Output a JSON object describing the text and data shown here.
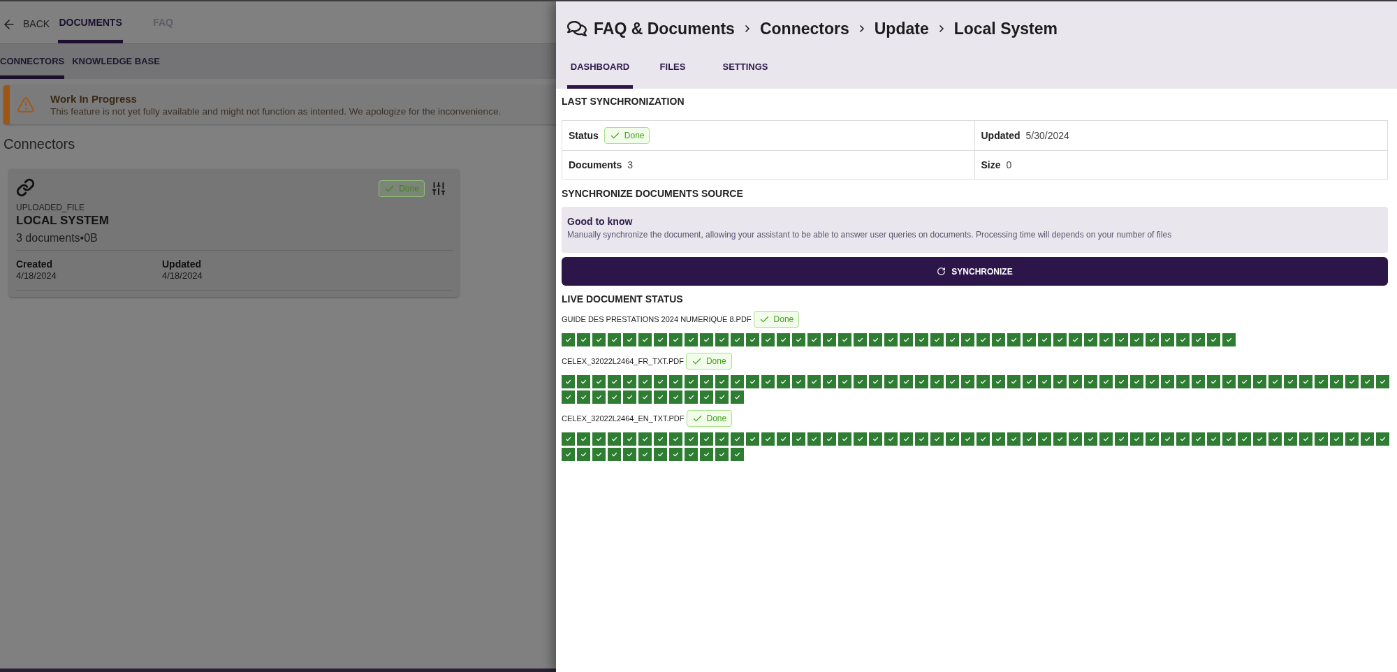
{
  "background_page": {
    "top_nav": {
      "back": "BACK",
      "tabs": [
        {
          "label": "DOCUMENTS",
          "selected": true
        },
        {
          "label": "FAQ",
          "selected": false
        }
      ]
    },
    "sub_tabs": [
      {
        "label": "CONNECTORS",
        "selected": true
      },
      {
        "label": "KNOWLEDGE BASE",
        "selected": false
      }
    ],
    "alert": {
      "title": "Work In Progress",
      "message": "This feature is not yet fully available and might not function as intented. We apologize for the inconvenience."
    },
    "heading": "Connectors",
    "connector_card": {
      "status": "Done",
      "type": "UPLOADED_FILE",
      "name": "LOCAL SYSTEM",
      "summary": "3 documents•0B",
      "fields": [
        {
          "label": "Created",
          "value": "4/18/2024"
        },
        {
          "label": "Updated",
          "value": "4/18/2024"
        }
      ]
    }
  },
  "panel": {
    "breadcrumb": [
      "FAQ & Documents",
      "Connectors",
      "Update",
      "Local System"
    ],
    "tabs": [
      {
        "label": "DASHBOARD",
        "selected": true
      },
      {
        "label": "FILES",
        "selected": false
      },
      {
        "label": "SETTINGS",
        "selected": false
      }
    ],
    "last_sync": {
      "title": "LAST SYNCHRONIZATION",
      "cells": [
        {
          "label": "Status",
          "kind": "badge",
          "value": "Done"
        },
        {
          "label": "Updated",
          "kind": "text",
          "value": "5/30/2024"
        },
        {
          "label": "Documents",
          "kind": "text",
          "value": "3"
        },
        {
          "label": "Size",
          "kind": "text",
          "value": "0"
        }
      ]
    },
    "sync_source": {
      "title": "SYNCHRONIZE DOCUMENTS SOURCE",
      "info": {
        "title": "Good to know",
        "text": "Manually synchronize the document, allowing your assistant to be able to answer user queries on documents. Processing time will depends on your number of files"
      },
      "button": "SYNCHRONIZE"
    },
    "live_status": {
      "title": "LIVE DOCUMENT STATUS",
      "documents": [
        {
          "name": "GUIDE DES PRESTATIONS 2024 NUMERIQUE 8.PDF",
          "status": "Done",
          "chunks": [
            {
              "done": true
            },
            {
              "done": true
            },
            {
              "done": true
            },
            {
              "done": true
            },
            {
              "done": true
            },
            {
              "done": true
            },
            {
              "done": true
            },
            {
              "done": true
            },
            {
              "done": true
            },
            {
              "done": true
            },
            {
              "done": true
            },
            {
              "done": true
            },
            {
              "done": true
            },
            {
              "done": true
            },
            {
              "done": true
            },
            {
              "done": true
            },
            {
              "done": true
            },
            {
              "done": true
            },
            {
              "done": true
            },
            {
              "done": true
            },
            {
              "done": true
            },
            {
              "done": true
            },
            {
              "done": true
            },
            {
              "done": true
            },
            {
              "done": true
            },
            {
              "done": true
            },
            {
              "done": true
            },
            {
              "done": true
            },
            {
              "done": true
            },
            {
              "done": true
            },
            {
              "done": true
            },
            {
              "done": true
            },
            {
              "done": true
            },
            {
              "done": true
            },
            {
              "done": true
            },
            {
              "done": true
            },
            {
              "done": true
            },
            {
              "done": true
            },
            {
              "done": true
            },
            {
              "done": true
            },
            {
              "done": true
            },
            {
              "done": true
            },
            {
              "done": true
            },
            {
              "done": true
            }
          ]
        },
        {
          "name": "CELEX_32022L2464_FR_TXT.PDF",
          "status": "Done",
          "chunks": [
            {
              "done": true
            },
            {
              "done": true
            },
            {
              "done": true
            },
            {
              "done": true
            },
            {
              "done": true
            },
            {
              "done": true
            },
            {
              "done": true
            },
            {
              "done": true
            },
            {
              "done": true
            },
            {
              "done": true
            },
            {
              "done": true
            },
            {
              "done": true
            },
            {
              "done": true
            },
            {
              "done": true
            },
            {
              "done": true
            },
            {
              "done": true
            },
            {
              "done": true
            },
            {
              "done": true
            },
            {
              "done": true
            },
            {
              "done": true
            },
            {
              "done": true
            },
            {
              "done": true
            },
            {
              "done": true
            },
            {
              "done": true
            },
            {
              "done": true
            },
            {
              "done": true
            },
            {
              "done": true
            },
            {
              "done": true
            },
            {
              "done": true
            },
            {
              "done": true
            },
            {
              "done": true
            },
            {
              "done": true
            },
            {
              "done": true
            },
            {
              "done": true
            },
            {
              "done": true
            },
            {
              "done": true
            },
            {
              "done": true
            },
            {
              "done": true
            },
            {
              "done": true
            },
            {
              "done": true
            },
            {
              "done": true
            },
            {
              "done": true
            },
            {
              "done": true
            },
            {
              "done": true
            },
            {
              "done": true
            },
            {
              "done": true
            },
            {
              "done": true
            },
            {
              "done": true
            },
            {
              "done": true
            },
            {
              "done": true
            },
            {
              "done": true
            },
            {
              "done": true
            },
            {
              "done": true
            },
            {
              "done": true
            },
            {
              "done": true
            },
            {
              "done": true
            },
            {
              "done": true
            },
            {
              "done": true
            },
            {
              "done": true
            },
            {
              "done": true
            },
            {
              "done": true
            },
            {
              "done": true
            },
            {
              "done": true
            },
            {
              "done": true
            },
            {
              "done": true
            },
            {
              "done": true
            }
          ]
        },
        {
          "name": "CELEX_32022L2464_EN_TXT.PDF",
          "status": "Done",
          "chunks": [
            {
              "done": true
            },
            {
              "done": true
            },
            {
              "done": true
            },
            {
              "done": true
            },
            {
              "done": true
            },
            {
              "done": true
            },
            {
              "done": true
            },
            {
              "done": true
            },
            {
              "done": true
            },
            {
              "done": true
            },
            {
              "done": true
            },
            {
              "done": true
            },
            {
              "done": true
            },
            {
              "done": true
            },
            {
              "done": true
            },
            {
              "done": true
            },
            {
              "done": true
            },
            {
              "done": true
            },
            {
              "done": true
            },
            {
              "done": true
            },
            {
              "done": true
            },
            {
              "done": true
            },
            {
              "done": true
            },
            {
              "done": true
            },
            {
              "done": true
            },
            {
              "done": true
            },
            {
              "done": true
            },
            {
              "done": true
            },
            {
              "done": true
            },
            {
              "done": true
            },
            {
              "done": true
            },
            {
              "done": true
            },
            {
              "done": true
            },
            {
              "done": true
            },
            {
              "done": true
            },
            {
              "done": true
            },
            {
              "done": true
            },
            {
              "done": true
            },
            {
              "done": true
            },
            {
              "done": true
            },
            {
              "done": true
            },
            {
              "done": true
            },
            {
              "done": true
            },
            {
              "done": true
            },
            {
              "done": true
            },
            {
              "done": true
            },
            {
              "done": true
            },
            {
              "done": true
            },
            {
              "done": true
            },
            {
              "done": true
            },
            {
              "done": true
            },
            {
              "done": true
            },
            {
              "done": true
            },
            {
              "done": true
            },
            {
              "done": true
            },
            {
              "done": true
            },
            {
              "done": true
            },
            {
              "done": true
            },
            {
              "done": true
            },
            {
              "done": true
            },
            {
              "done": true
            },
            {
              "done": true
            },
            {
              "done": true
            },
            {
              "done": true
            },
            {
              "done": true
            },
            {
              "done": true
            }
          ]
        }
      ]
    }
  }
}
